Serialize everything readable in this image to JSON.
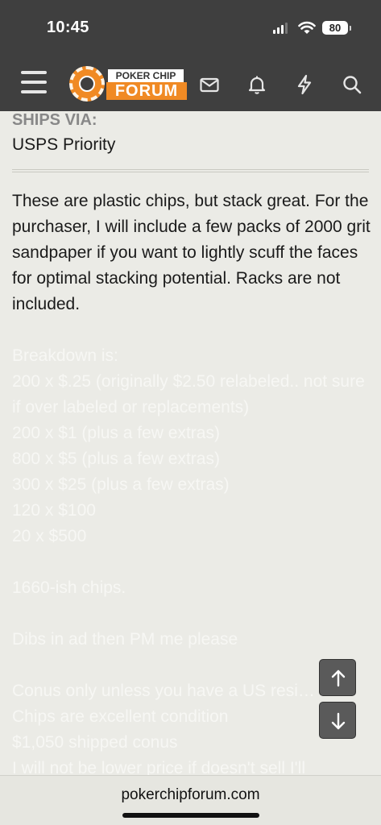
{
  "status_bar": {
    "time": "10:45",
    "battery": "80"
  },
  "nav": {
    "logo_top": "POKER CHIP",
    "logo_bottom": "FORUM",
    "icons": [
      "hamburger-menu-icon",
      "envelope-icon",
      "bell-icon",
      "lightning-bolt-icon",
      "search-icon"
    ]
  },
  "post": {
    "ships_label": "SHIPS VIA:",
    "ships_value": "USPS Priority",
    "description": "These are plastic chips, but stack great. For the purchaser, I will include a few packs of 2000 grit sandpaper if you want to lightly scuff the faces for optimal stacking potential. Racks are not included.",
    "breakdown_heading": "Breakdown is:",
    "breakdown_line_1": "200 x $.25 (originally $2.50 relabeled.. not sure if over labeled or replacements)",
    "breakdown_line_2": "200 x $1 (plus a few extras)",
    "breakdown_line_3": "800 x $5 (plus a few extras)",
    "breakdown_line_4": "300 x $25 (plus a few extras)",
    "breakdown_line_5": "120 x $100",
    "breakdown_line_6": "20 x $500",
    "total_chips": "1660-ish chips.",
    "dibs": "Dibs in ad then PM me please",
    "conus": "Conus only unless you have a US resi… r",
    "condition": "Chips are excellent condition",
    "price": "$1,050 shipped conus",
    "lower_price": "I will not be lower price if doesn't sell I'll"
  },
  "browser": {
    "url": "pokerchipforum.com"
  },
  "colors": {
    "nav_bg": "#3f3f3f",
    "brand_orange": "#f08a24",
    "page_bg": "#ebebe6"
  }
}
